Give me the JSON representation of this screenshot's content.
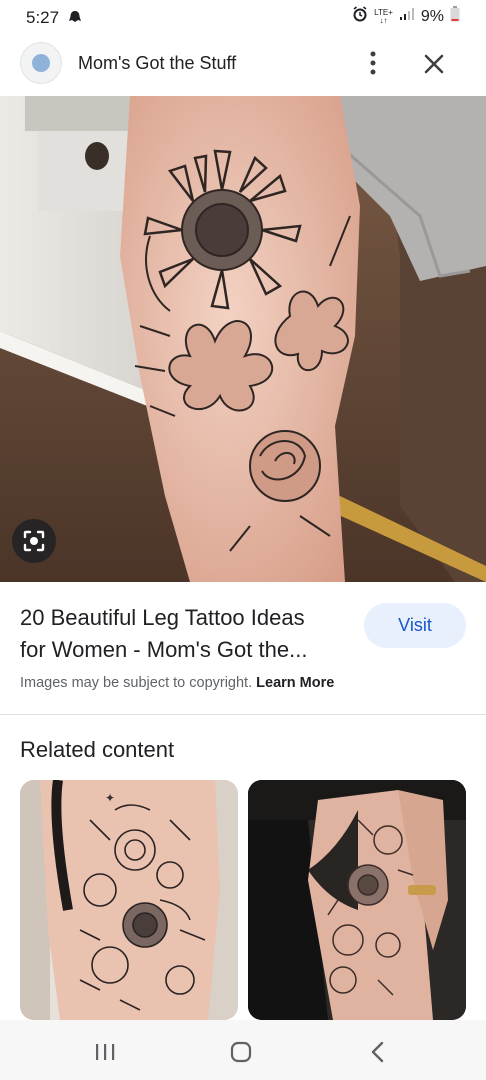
{
  "status_bar": {
    "time": "5:27",
    "network_top": "LTE+",
    "network_bottom": "↓↑",
    "battery": "9%",
    "icons": [
      "ghost-icon",
      "alarm-icon",
      "signal-icon",
      "battery-icon"
    ]
  },
  "header": {
    "site_name": "Mom's Got the Stuff",
    "icons": [
      "site-favicon",
      "more-vert-icon",
      "close-icon"
    ]
  },
  "hero": {
    "description_icon": "tattoo-photo",
    "lens_icon": "google-lens-icon"
  },
  "result": {
    "title_line1": "20 Beautiful Leg Tattoo Ideas",
    "title_line2": "for Women - Mom's Got the...",
    "visit_label": "Visit",
    "copyright_text": "Images may be subject to copyright.",
    "learn_more_label": "Learn More"
  },
  "related": {
    "heading": "Related content"
  },
  "nav_bar": {
    "icons": [
      "recents-icon",
      "home-icon",
      "back-icon"
    ]
  },
  "colors": {
    "accent_blue": "#1a56c4",
    "visit_bg": "#e8f0fe",
    "text_primary": "#202124",
    "text_secondary": "#5f6368"
  }
}
